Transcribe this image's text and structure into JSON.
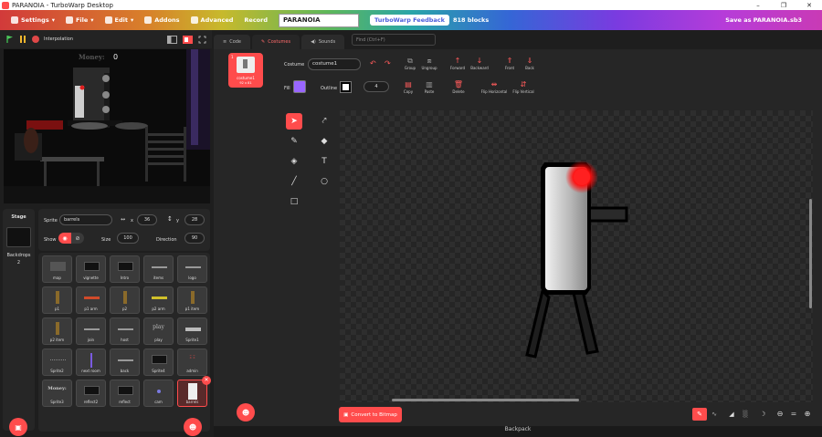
{
  "window": {
    "title": "PARANOIA - TurboWarp Desktop",
    "minimize": "–",
    "maximize": "❐",
    "close": "✕"
  },
  "menubar": {
    "settings": "Settings",
    "file": "File",
    "edit": "Edit",
    "addons": "Addons",
    "advanced": "Advanced",
    "record": "Record",
    "project_title": "PARANOIA",
    "feedback": "TurboWarp Feedback",
    "blocks": "818 blocks",
    "save_as": "Save as PARANOIA.sb3"
  },
  "stage_controls": {
    "interpolation": "Interpolation"
  },
  "stage_view": {
    "money_label": "Money:",
    "money_value": "0"
  },
  "tabs": {
    "code": "Code",
    "costumes": "Costumes",
    "sounds": "Sounds"
  },
  "find": {
    "placeholder": "Find (Ctrl+F)"
  },
  "sprite_info": {
    "sprite_label": "Sprite",
    "sprite_name": "barrels",
    "x_label": "x",
    "x_value": "36",
    "y_label": "y",
    "y_value": "28",
    "show_label": "Show",
    "size_label": "Size",
    "size_value": "100",
    "direction_label": "Direction",
    "direction_value": "90"
  },
  "stage_panel": {
    "title": "Stage",
    "backdrops_label": "Backdrops",
    "backdrops_count": "2"
  },
  "sprites": [
    {
      "name": "map"
    },
    {
      "name": "vignette"
    },
    {
      "name": "Intro"
    },
    {
      "name": "items"
    },
    {
      "name": "logo"
    },
    {
      "name": "p1"
    },
    {
      "name": "p1 arm"
    },
    {
      "name": "p2"
    },
    {
      "name": "p2 arm"
    },
    {
      "name": "p1 item"
    },
    {
      "name": "p2 item"
    },
    {
      "name": "join"
    },
    {
      "name": "host"
    },
    {
      "name": "play"
    },
    {
      "name": "Sprite1"
    },
    {
      "name": "Sprite2"
    },
    {
      "name": "next room"
    },
    {
      "name": "back"
    },
    {
      "name": "Sprite4"
    },
    {
      "name": "admin"
    },
    {
      "name": "Sprite3"
    },
    {
      "name": "reflect2"
    },
    {
      "name": "reflect"
    },
    {
      "name": "cam"
    },
    {
      "name": "barrels"
    }
  ],
  "sprite_tile_text": {
    "play": "play",
    "money": "Money:",
    "admin": "Ξ  Ξ"
  },
  "costume_item": {
    "name": "costume1",
    "size": "92 x 81",
    "index": "1"
  },
  "costume_editor": {
    "costume_label": "Costume",
    "costume_name": "costume1",
    "fill_label": "Fill",
    "outline_label": "Outline",
    "outline_width": "4",
    "fill_color": "#9966ff",
    "group": "Group",
    "ungroup": "Ungroup",
    "forward": "Forward",
    "backward": "Backward",
    "front": "Front",
    "back": "Back",
    "copy": "Copy",
    "paste": "Paste",
    "delete": "Delete",
    "flip_h": "Flip Horizontal",
    "flip_v": "Flip Vertical",
    "convert": "Convert to Bitmap",
    "zoom_out": "⊖",
    "zoom_reset": "=",
    "zoom_in": "⊕"
  },
  "bottom": {
    "backpack": "Backpack"
  },
  "colors": {
    "accent": "#ff4c4c",
    "panel": "#262626",
    "background": "#1e1e1e"
  }
}
